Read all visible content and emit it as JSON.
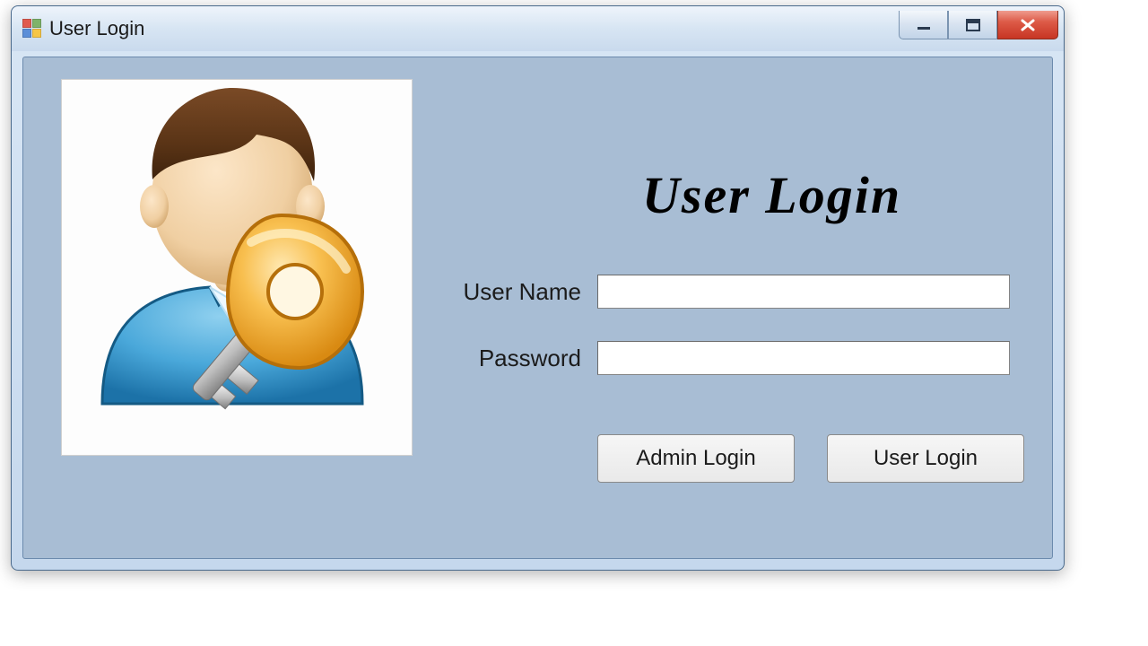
{
  "window": {
    "title": "User Login"
  },
  "form": {
    "heading": "User Login",
    "username_label": "User Name",
    "username_value": "",
    "password_label": "Password",
    "password_value": ""
  },
  "buttons": {
    "admin_login": "Admin Login",
    "user_login": "User Login"
  }
}
